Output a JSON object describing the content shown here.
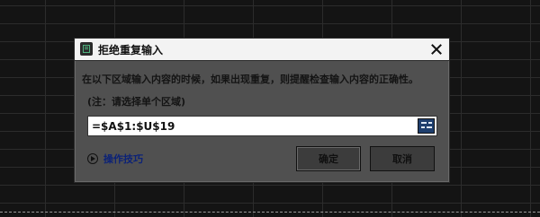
{
  "dialog": {
    "title": "拒绝重复输入",
    "description": "在以下区域输入内容的时候，如果出现重复，则提醒检查输入内容的正确性。",
    "note": "(注：请选择单个区域)",
    "range_value": "=$A$1:$U$19",
    "tips_label": "操作技巧",
    "ok_label": "确定",
    "cancel_label": "取消"
  },
  "icons": {
    "app": "spreadsheet-app-icon",
    "close": "close-icon",
    "range_picker": "range-select-icon",
    "tips": "play-circle-icon"
  },
  "colors": {
    "dialog_background": "#505050",
    "titlebar_background": "#f3f3f3",
    "link_text": "#0c2277",
    "picker_button": "#1f3f6e"
  }
}
